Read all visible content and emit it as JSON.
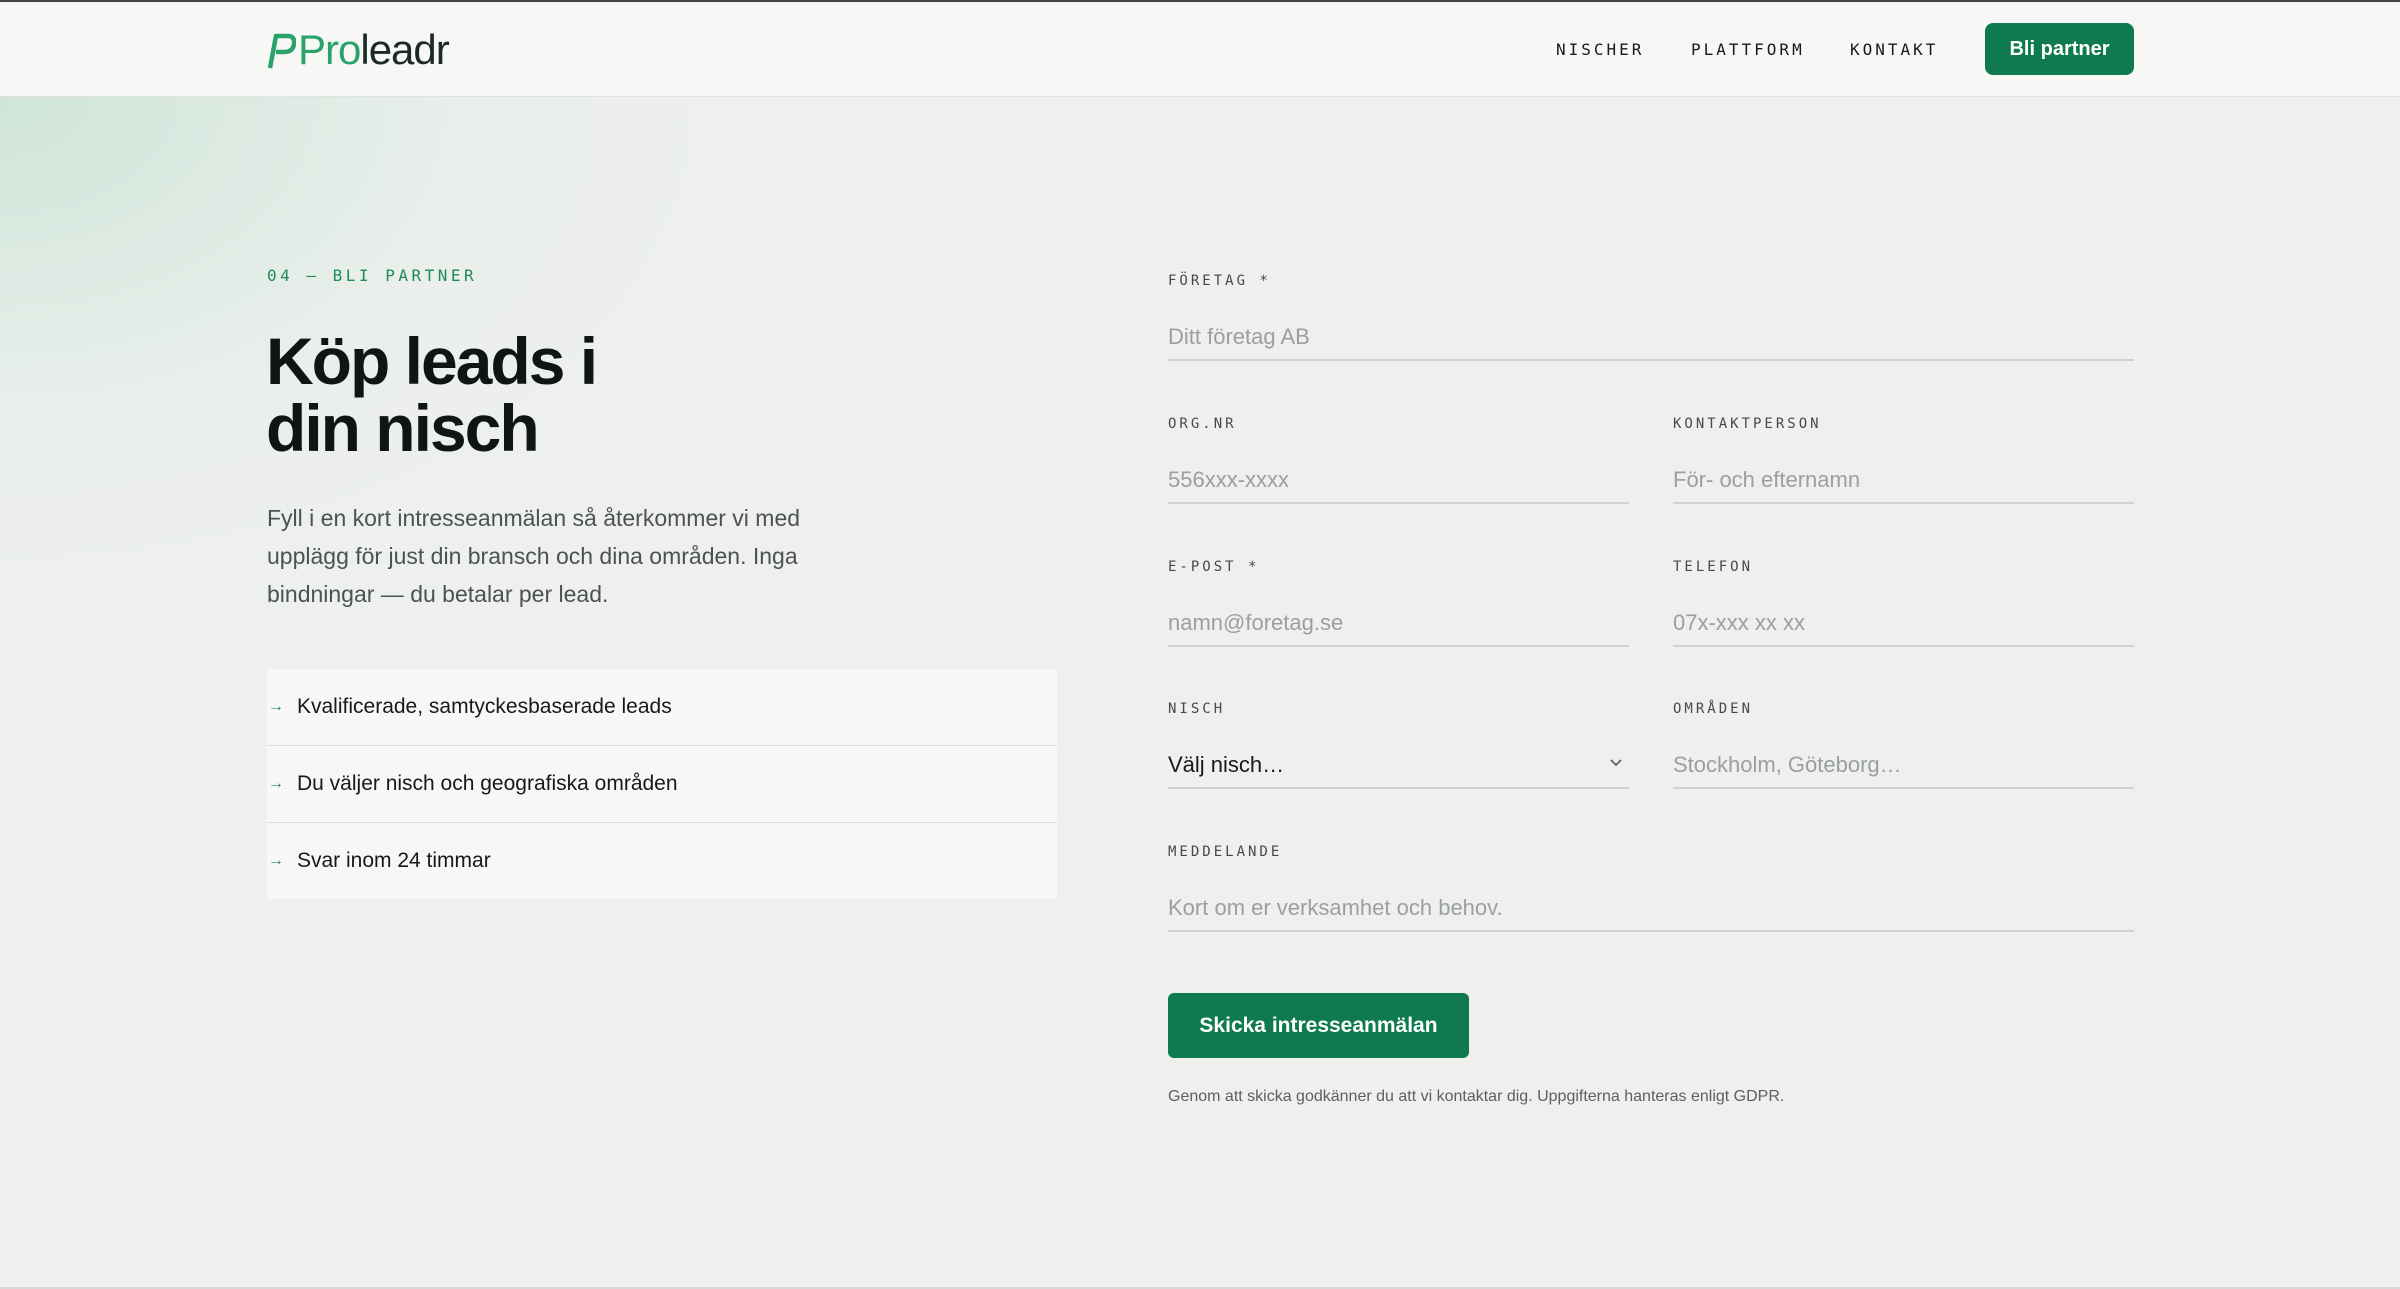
{
  "header": {
    "logo": {
      "part_a": "Pro",
      "part_b": "leadr"
    },
    "nav": [
      "NISCHER",
      "PLATTFORM",
      "KONTAKT"
    ],
    "cta_label": "Bli partner"
  },
  "hero": {
    "eyebrow": "04 — BLI PARTNER",
    "title_line1": "Köp leads i",
    "title_line2": "din nisch",
    "description": "Fyll i en kort intresseanmälan så återkommer vi med upplägg för just din bransch och dina områden. Inga bindningar — du betalar per lead.",
    "features": [
      "Kvalificerade, samtyckesbaserade leads",
      "Du väljer nisch och geografiska områden",
      "Svar inom 24 timmar"
    ]
  },
  "form": {
    "company": {
      "label": "FÖRETAG *",
      "placeholder": "Ditt företag AB"
    },
    "orgnr": {
      "label": "ORG.NR",
      "placeholder": "556xxx-xxxx"
    },
    "contact": {
      "label": "KONTAKTPERSON",
      "placeholder": "För- och efternamn"
    },
    "email": {
      "label": "E-POST *",
      "placeholder": "namn@foretag.se"
    },
    "phone": {
      "label": "TELEFON",
      "placeholder": "07x-xxx xx xx"
    },
    "niche": {
      "label": "NISCH",
      "value": "Välj nisch…"
    },
    "areas": {
      "label": "OMRÅDEN",
      "placeholder": "Stockholm, Göteborg…"
    },
    "message": {
      "label": "MEDDELANDE",
      "placeholder": "Kort om er verksamhet och behov."
    },
    "submit_label": "Skicka intresseanmälan",
    "consent": "Genom att skicka godkänner du att vi kontaktar dig. Uppgifterna hanteras enligt GDPR."
  },
  "colors": {
    "accent": "#0f7a4f",
    "accent_light": "#2aa36a",
    "background": "#eff0ee"
  }
}
